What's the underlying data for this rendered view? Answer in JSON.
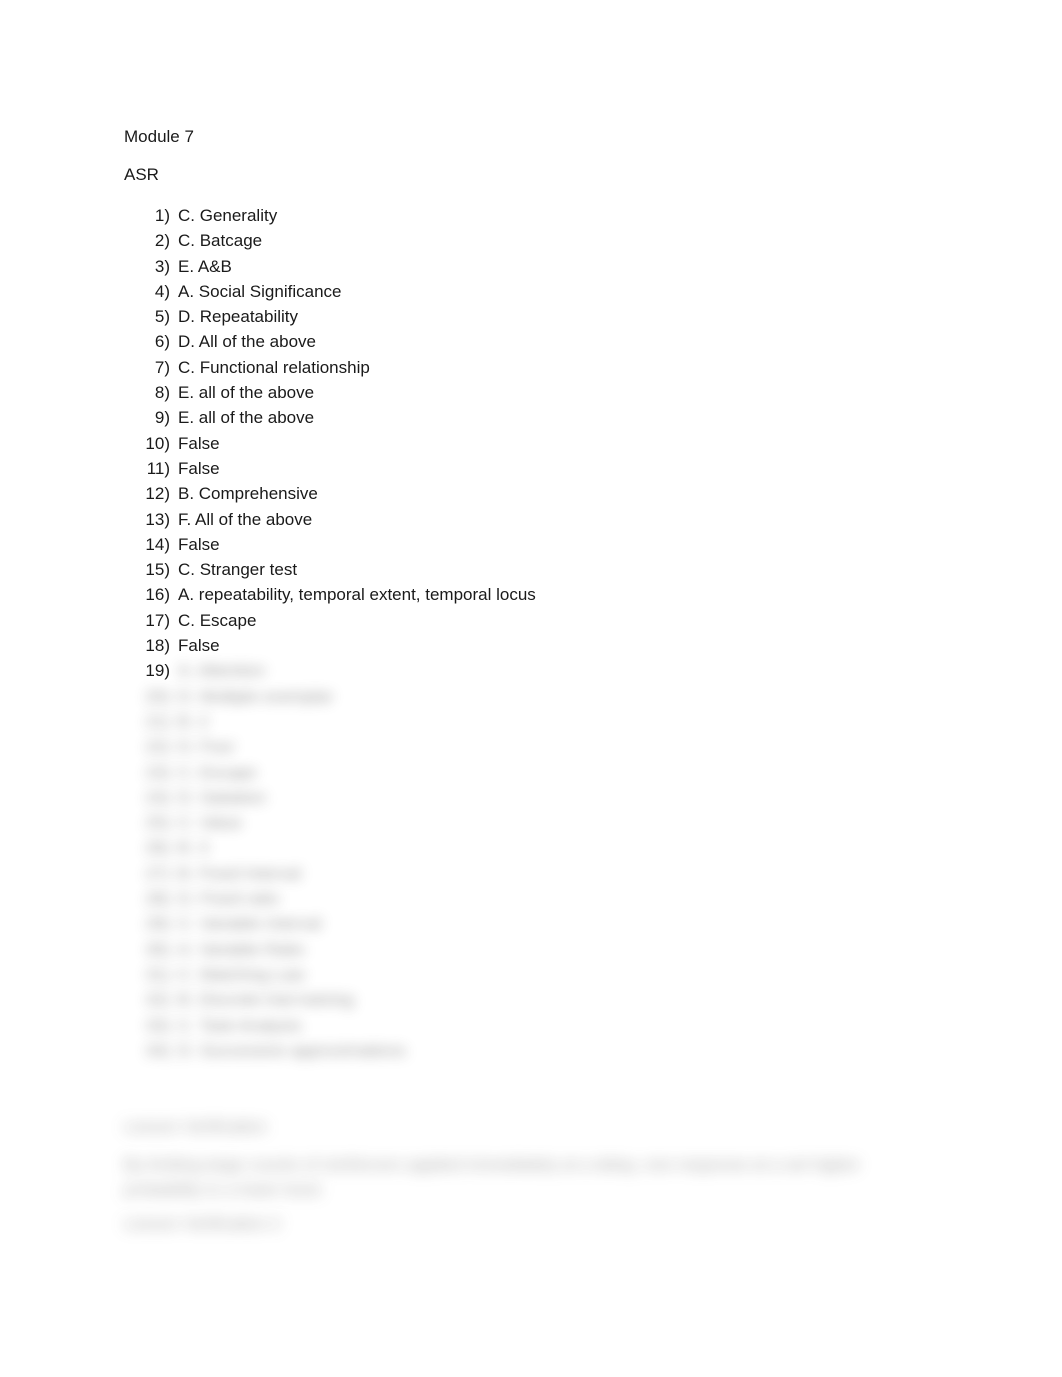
{
  "document": {
    "title": "Module 7",
    "subtitle": "ASR"
  },
  "answers": {
    "visible": [
      {
        "num": "1)",
        "text": "C. Generality"
      },
      {
        "num": "2)",
        "text": "C. Batcage"
      },
      {
        "num": "3)",
        "text": "E. A&B"
      },
      {
        "num": "4)",
        "text": "A. Social Significance"
      },
      {
        "num": "5)",
        "text": "D. Repeatability"
      },
      {
        "num": "6)",
        "text": "D. All of the above"
      },
      {
        "num": "7)",
        "text": "C. Functional relationship"
      },
      {
        "num": "8)",
        "text": "E. all of the above"
      },
      {
        "num": "9)",
        "text": "E. all of the above"
      },
      {
        "num": "10)",
        "text": "False"
      },
      {
        "num": "11)",
        "text": "False"
      },
      {
        "num": "12)",
        "text": "B. Comprehensive"
      },
      {
        "num": "13)",
        "text": "F. All of the above"
      },
      {
        "num": "14)",
        "text": "False"
      },
      {
        "num": "15)",
        "text": "C. Stranger test"
      },
      {
        "num": "16)",
        "text": "A. repeatability, temporal extent, temporal locus"
      },
      {
        "num": "17)",
        "text": "C. Escape"
      },
      {
        "num": "18)",
        "text": "False"
      }
    ],
    "redacted": [
      {
        "num": "19)",
        "text": "A. Attention"
      },
      {
        "num": "20)",
        "text": "D. Multiple exemplar"
      },
      {
        "num": "21)",
        "text": "B. 2"
      },
      {
        "num": "22)",
        "text": "D. Four"
      },
      {
        "num": "23)",
        "text": "C. Escape"
      },
      {
        "num": "24)",
        "text": "D. Satiation"
      },
      {
        "num": "25)",
        "text": "C. Value"
      },
      {
        "num": "26)",
        "text": "B. 3"
      },
      {
        "num": "27)",
        "text": "B. Fixed Interval"
      },
      {
        "num": "28)",
        "text": "D. Fixed ratio"
      },
      {
        "num": "29)",
        "text": "C. Variable Interval"
      },
      {
        "num": "30)",
        "text": "A. Variable Ratio"
      },
      {
        "num": "31)",
        "text": "C. Matching Law"
      },
      {
        "num": "32)",
        "text": "B. Discrete trial training"
      },
      {
        "num": "33)",
        "text": "C. Task Analysis"
      },
      {
        "num": "34)",
        "text": "D. Successive approximations"
      }
    ]
  },
  "sections": [
    {
      "heading": "Lesson Verification",
      "body": "By limiting large counts of reinforcers applied immediately at a delay, one response at a set higher probability to a lower level."
    },
    {
      "heading": "Lesson Verification 2",
      "body": ""
    }
  ]
}
